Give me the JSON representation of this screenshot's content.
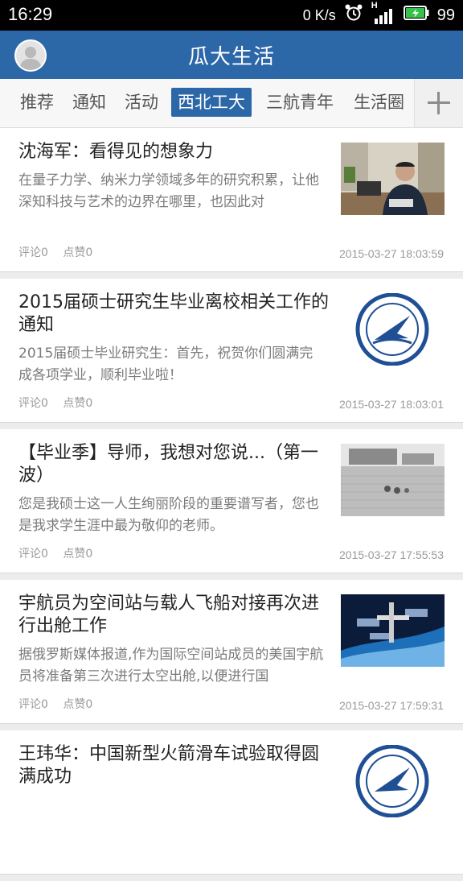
{
  "status_bar": {
    "time": "16:29",
    "net_speed": "0 K/s",
    "signal_label": "H",
    "battery": "99"
  },
  "app": {
    "title": "瓜大生活",
    "accent_color": "#2c67a8",
    "avatar_icon": "user-avatar-icon"
  },
  "tabs": [
    {
      "label": "推荐",
      "active": false
    },
    {
      "label": "通知",
      "active": false
    },
    {
      "label": "活动",
      "active": false
    },
    {
      "label": "西北工大",
      "active": true
    },
    {
      "label": "三航青年",
      "active": false
    },
    {
      "label": "生活圈",
      "active": false
    }
  ],
  "articles": [
    {
      "title": "沈海军：看得见的想象力",
      "summary": "在量子力学、纳米力学领域多年的研究积累，让他深知科技与艺术的边界在哪里，也因此对",
      "comments": "评论0",
      "likes": "点赞0",
      "time": "2015-03-27 18:03:59",
      "thumb": "office-portrait-photo"
    },
    {
      "title": "2015届硕士研究生毕业离校相关工作的通知",
      "summary": "2015届硕士毕业研究生：首先，祝贺你们圆满完成各项学业，顺利毕业啦！",
      "comments": "评论0",
      "likes": "点赞0",
      "time": "2015-03-27 18:03:01",
      "thumb": "university-emblem"
    },
    {
      "title": "【毕业季】导师，我想对您说...（第一波）",
      "summary": "您是我硕士这一人生绚丽阶段的重要谱写者，您也是我求学生涯中最为敬仰的老师。",
      "comments": "评论0",
      "likes": "点赞0",
      "time": "2015-03-27 17:55:53",
      "thumb": "campus-bw-photo"
    },
    {
      "title": "宇航员为空间站与载人飞船对接再次进行出舱工作",
      "summary": "据俄罗斯媒体报道,作为国际空间站成员的美国宇航员将准备第三次进行太空出舱,以便进行国",
      "comments": "评论0",
      "likes": "点赞0",
      "time": "2015-03-27 17:59:31",
      "thumb": "space-station-photo"
    },
    {
      "title": "王玮华：中国新型火箭滑车试验取得圆满成功",
      "summary": "",
      "comments": "",
      "likes": "",
      "time": "",
      "thumb": "university-emblem"
    }
  ]
}
